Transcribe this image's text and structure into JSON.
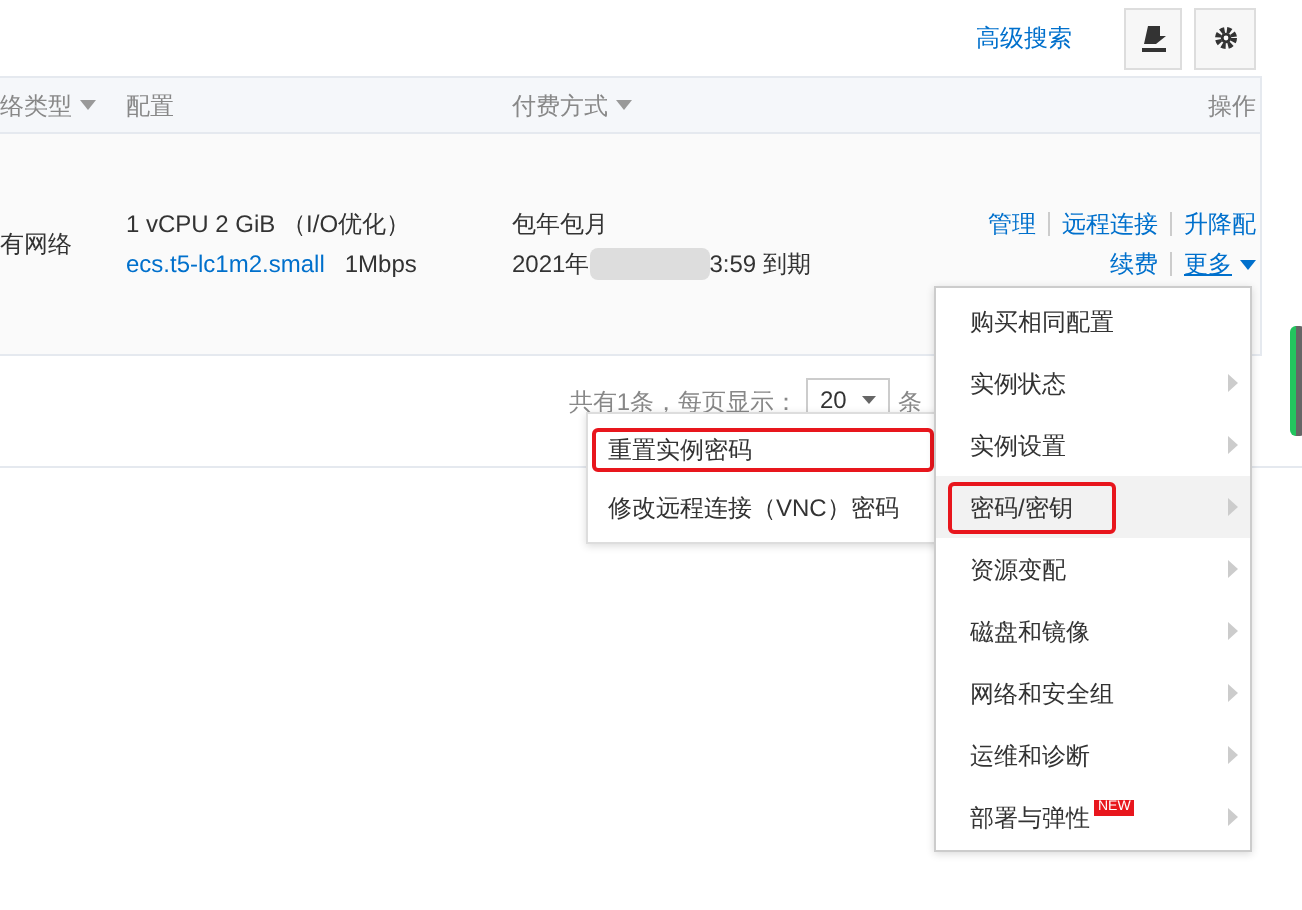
{
  "toolbar": {
    "advanced_search": "高级搜索"
  },
  "table": {
    "columns": [
      {
        "label": "络类型",
        "sortable": true
      },
      {
        "label": "配置",
        "sortable": false
      },
      {
        "label": "付费方式",
        "sortable": true
      },
      {
        "label": "操作",
        "sortable": false
      }
    ],
    "rows": [
      {
        "network": "有网络",
        "spec": "1 vCPU 2 GiB （I/O优化）",
        "instance_type": "ecs.t5-lc1m2.small",
        "bandwidth": "1Mbps",
        "billing": "包年包月",
        "expiry_start": "2021年",
        "expiry_end": "3:59 到期",
        "actions": [
          "管理",
          "远程连接",
          "升降配",
          "续费"
        ],
        "more": "更多"
      }
    ]
  },
  "pagination": {
    "total": "共有1条，每页显示：",
    "page_size": "20",
    "unit": "条"
  },
  "menu": {
    "items": [
      {
        "label": "购买相同配置",
        "submenu": false,
        "selected": false,
        "highlighted": false
      },
      {
        "label": "实例状态",
        "submenu": true,
        "selected": false,
        "highlighted": false
      },
      {
        "label": "实例设置",
        "submenu": true,
        "selected": false,
        "highlighted": false
      },
      {
        "label": "密码/密钥",
        "submenu": true,
        "selected": true,
        "highlighted": true
      },
      {
        "label": "资源变配",
        "submenu": true,
        "selected": false,
        "highlighted": false
      },
      {
        "label": "磁盘和镜像",
        "submenu": true,
        "selected": false,
        "highlighted": false
      },
      {
        "label": "网络和安全组",
        "submenu": true,
        "selected": false,
        "highlighted": false
      },
      {
        "label": "运维和诊断",
        "submenu": true,
        "selected": false,
        "highlighted": false
      },
      {
        "label": "部署与弹性",
        "submenu": true,
        "selected": false,
        "highlighted": false,
        "badge": "NEW"
      }
    ]
  },
  "submenu": {
    "items": [
      {
        "label": "重置实例密码",
        "highlighted": true
      },
      {
        "label": "修改远程连接（VNC）密码",
        "highlighted": false
      }
    ]
  }
}
